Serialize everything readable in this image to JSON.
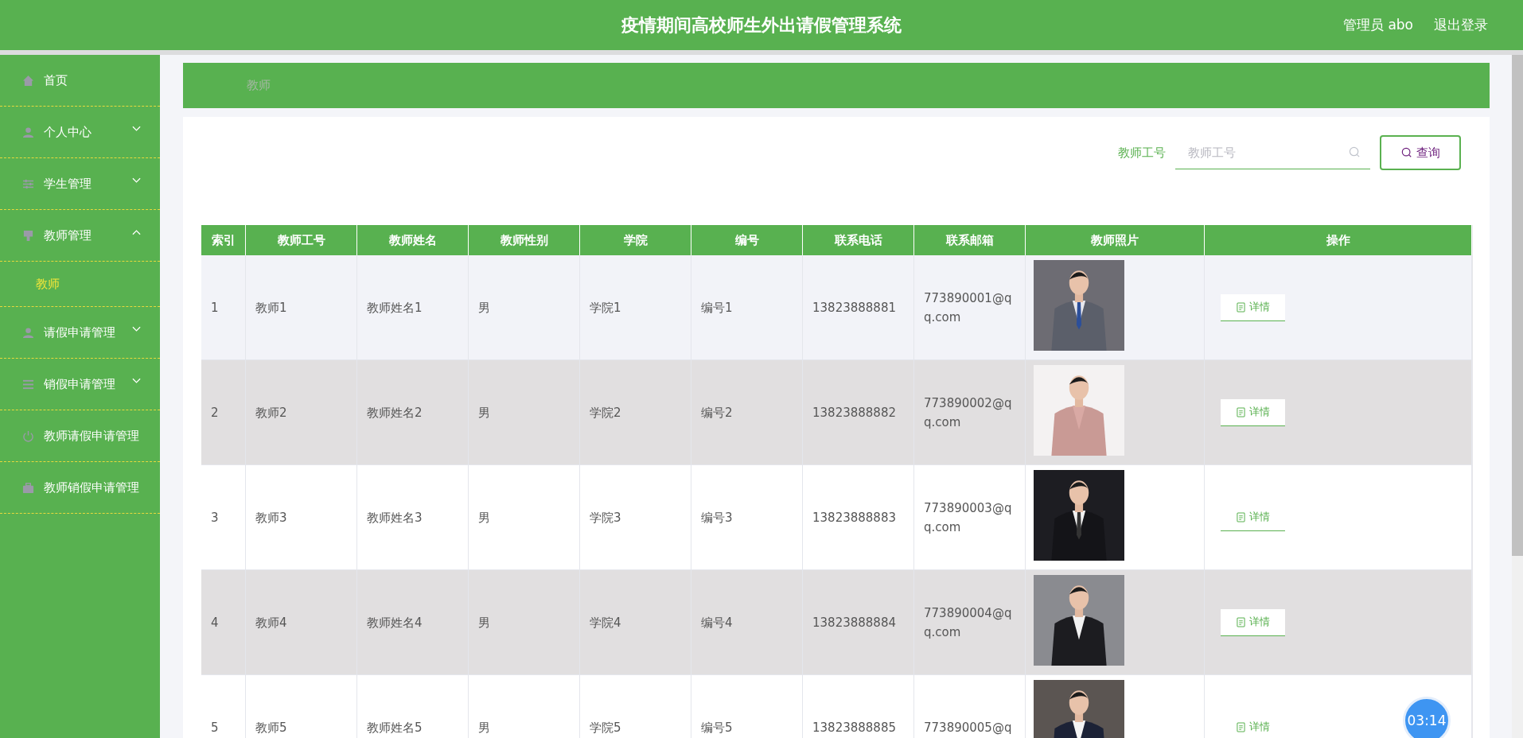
{
  "header": {
    "title": "疫情期间高校师生外出请假管理系统",
    "user": "管理员 abo",
    "logout": "退出登录"
  },
  "sidebar": {
    "items": [
      {
        "label": "首页"
      },
      {
        "label": "个人中心",
        "expanded": false
      },
      {
        "label": "学生管理",
        "expanded": false
      },
      {
        "label": "教师管理",
        "expanded": true,
        "children": [
          {
            "label": "教师",
            "selected": true
          }
        ]
      },
      {
        "label": "请假申请管理",
        "expanded": false
      },
      {
        "label": "销假申请管理",
        "expanded": false
      },
      {
        "label": "教师请假申请管理"
      },
      {
        "label": "教师销假申请管理"
      }
    ]
  },
  "breadcrumb": "教师",
  "search": {
    "label": "教师工号",
    "placeholder": "教师工号",
    "button": "查询"
  },
  "table": {
    "columns": [
      "索引",
      "教师工号",
      "教师姓名",
      "教师性别",
      "学院",
      "编号",
      "联系电话",
      "联系邮箱",
      "教师照片",
      "操作"
    ],
    "rows": [
      {
        "hovered": true,
        "cells": [
          "1",
          "教师1",
          "教师姓名1",
          "男",
          "学院1",
          "编号1",
          "13823888881",
          "773890001@qq.com"
        ],
        "action": "详情"
      },
      {
        "hovered": false,
        "cells": [
          "2",
          "教师2",
          "教师姓名2",
          "男",
          "学院2",
          "编号2",
          "13823888882",
          "773890002@qq.com"
        ],
        "action": "详情"
      },
      {
        "hovered": false,
        "cells": [
          "3",
          "教师3",
          "教师姓名3",
          "男",
          "学院3",
          "编号3",
          "13823888883",
          "773890003@qq.com"
        ],
        "action": "详情"
      },
      {
        "hovered": false,
        "cells": [
          "4",
          "教师4",
          "教师姓名4",
          "男",
          "学院4",
          "编号4",
          "13823888884",
          "773890004@qq.com"
        ],
        "action": "详情"
      },
      {
        "hovered": false,
        "cells": [
          "5",
          "教师5",
          "教师姓名5",
          "男",
          "学院5",
          "编号5",
          "13823888885",
          "773890005@q"
        ],
        "action": "详情"
      }
    ]
  },
  "timer": "03:14"
}
